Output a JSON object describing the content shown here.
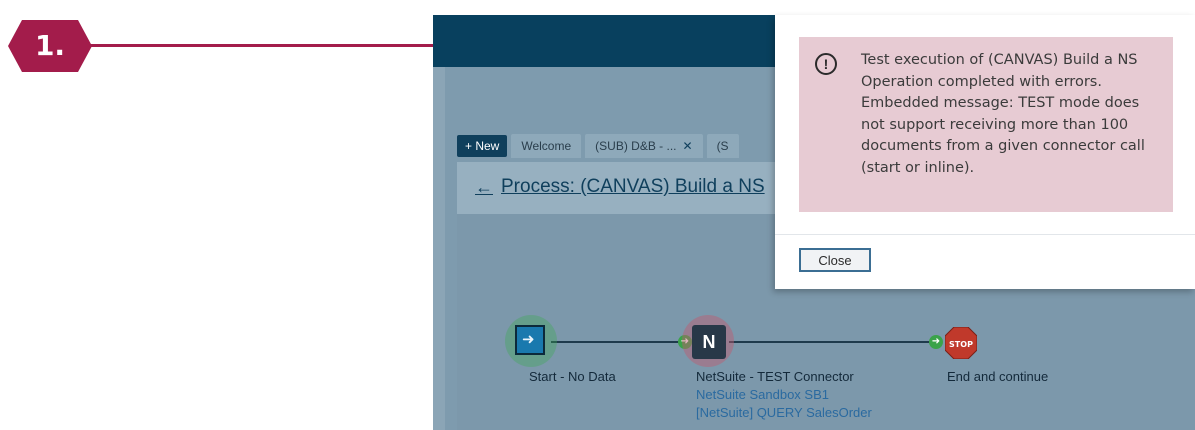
{
  "step": {
    "number": "1.",
    "color": "#a31c4b"
  },
  "tabs": {
    "new_label": "+ New",
    "items": [
      {
        "label": "Welcome",
        "close": ""
      },
      {
        "label": "(SUB) D&B - ...",
        "close": "✕"
      },
      {
        "label": "(S",
        "close": ""
      }
    ]
  },
  "process": {
    "title": "Process: (CANVAS) Build a NS"
  },
  "shapes": {
    "start": {
      "label": "Start - No Data"
    },
    "connector": {
      "label": "NetSuite - TEST Connector",
      "sub1": "NetSuite Sandbox SB1",
      "sub2": "[NetSuite] QUERY SalesOrder",
      "icon_letter": "N"
    },
    "end": {
      "label": "End and continue",
      "stop_text": "STOP"
    }
  },
  "dialog": {
    "message": "Test execution of (CANVAS) Build a NS Operation completed with errors. Embedded message: TEST mode does not support receiving more than 100 documents from a given connector call (start or inline).",
    "icon": "exclamation-icon",
    "close_label": "Close"
  },
  "colors": {
    "header": "#08405e",
    "alert_bg": "#e7cbd3",
    "accent": "#a31c4b"
  }
}
